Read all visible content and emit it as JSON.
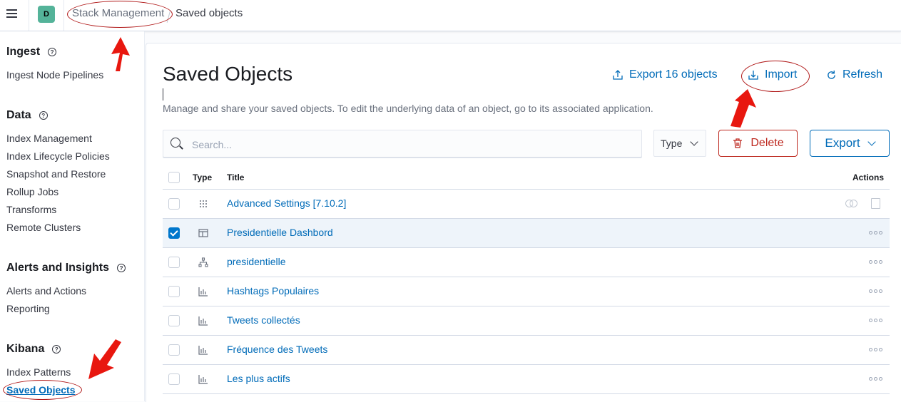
{
  "header": {
    "space_initial": "D",
    "breadcrumb_parent": "Stack Management",
    "breadcrumb_current": "Saved objects"
  },
  "sidebar": {
    "sections": [
      {
        "title": "Ingest",
        "items": [
          "Ingest Node Pipelines"
        ]
      },
      {
        "title": "Data",
        "items": [
          "Index Management",
          "Index Lifecycle Policies",
          "Snapshot and Restore",
          "Rollup Jobs",
          "Transforms",
          "Remote Clusters"
        ]
      },
      {
        "title": "Alerts and Insights",
        "items": [
          "Alerts and Actions",
          "Reporting"
        ]
      },
      {
        "title": "Kibana",
        "items": [
          "Index Patterns",
          "Saved Objects"
        ]
      }
    ],
    "active_item": "Saved Objects"
  },
  "main": {
    "title": "Saved Objects",
    "description": "Manage and share your saved objects. To edit the underlying data of an object, go to its associated application.",
    "export_all_label": "Export 16 objects",
    "import_label": "Import",
    "refresh_label": "Refresh",
    "search_placeholder": "Search...",
    "type_filter_label": "Type",
    "delete_label": "Delete",
    "export_label": "Export"
  },
  "table": {
    "columns": {
      "type": "Type",
      "title": "Title",
      "actions": "Actions"
    },
    "rows": [
      {
        "title": "Advanced Settings [7.10.2]",
        "type_icon": "advanced-settings-icon",
        "selected": false
      },
      {
        "title": "Presidentielle Dashbord",
        "type_icon": "dashboard-icon",
        "selected": true
      },
      {
        "title": "presidentielle",
        "type_icon": "index-pattern-icon",
        "selected": false
      },
      {
        "title": "Hashtags Populaires",
        "type_icon": "visualization-icon",
        "selected": false
      },
      {
        "title": "Tweets collectés",
        "type_icon": "visualization-icon",
        "selected": false
      },
      {
        "title": "Fréquence des Tweets",
        "type_icon": "visualization-icon",
        "selected": false
      },
      {
        "title": "Les plus actifs",
        "type_icon": "visualization-icon",
        "selected": false
      }
    ]
  },
  "colors": {
    "link": "#006bb8",
    "danger": "#bd271e",
    "checkbox_checked": "#0077cc",
    "annotation": "#e8170f",
    "space_avatar": "#54b399"
  }
}
